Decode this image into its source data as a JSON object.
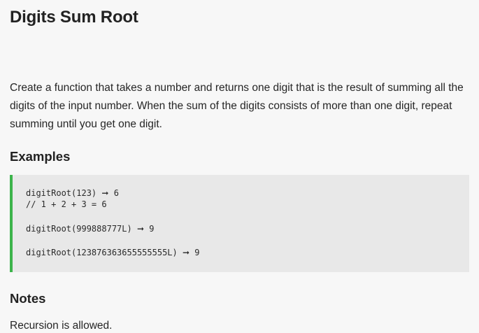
{
  "page": {
    "title": "Digits Sum Root",
    "description": "Create a function that takes a number and returns one digit that is the result of summing all the digits of the input number. When the sum of the digits consists of more than one digit, repeat summing until you get one digit."
  },
  "examples": {
    "heading": "Examples",
    "arrow_glyph": "➞",
    "lines": [
      {
        "call": "digitRoot(123)",
        "result": "6"
      },
      {
        "comment": "// 1 + 2 + 3 = 6"
      },
      {
        "call": "digitRoot(999888777L)",
        "result": "9"
      },
      {
        "call": "digitRoot(123876363655555555L)",
        "result": "9"
      }
    ]
  },
  "notes": {
    "heading": "Notes",
    "text": "Recursion is allowed."
  },
  "colors": {
    "background": "#f7f7f7",
    "code_background": "#e8e8e8",
    "code_accent": "#3cb44b"
  }
}
